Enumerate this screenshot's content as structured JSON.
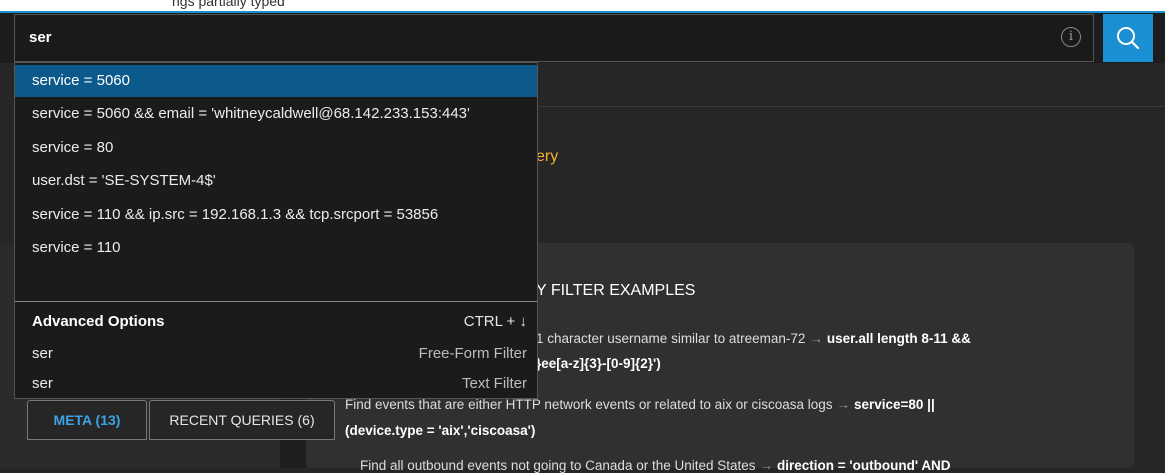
{
  "header": {
    "top_clip_text": "ngs partially typed",
    "search_value": "ser",
    "info_icon": "info-icon",
    "search_icon": "search-icon",
    "accent": "#1a8fd1"
  },
  "dropdown": {
    "suggestions": [
      "service = 5060",
      "service = 5060 && email = 'whitneycaldwell@68.142.233.153:443'",
      "service = 80",
      "user.dst = 'SE-SYSTEM-4$'",
      "service = 110 && ip.src = 192.168.1.3 && tcp.srcport = 53856",
      "service = 110"
    ],
    "advanced": {
      "title": "Advanced Options",
      "shortcut": "CTRL + ↓",
      "options": [
        {
          "value": "ser",
          "type": "Free-Form Filter"
        },
        {
          "value": "ser",
          "type": "Text Filter"
        }
      ]
    }
  },
  "main": {
    "query_fragment": "ery",
    "examples_title": "Y FILTER EXAMPLES",
    "examples": [
      {
        "line1_text": "1 character username similar to atreeman-72",
        "line1_query": "user.all length 8-11 &&",
        "line2_query": "}ee[a-z]{3}-[0-9]{2}')"
      },
      {
        "line1_text": "Find events that are either HTTP network events or related to aix or ciscoasa logs",
        "line1_query": "service=80 ||",
        "line2_query": "(device.type = 'aix','ciscoasa')"
      },
      {
        "line1_text": "Find all outbound events not going to Canada or the United States",
        "line1_query": "direction = 'outbound' AND"
      }
    ]
  },
  "tabs": {
    "meta": "META (13)",
    "recent": "RECENT QUERIES (6)"
  }
}
